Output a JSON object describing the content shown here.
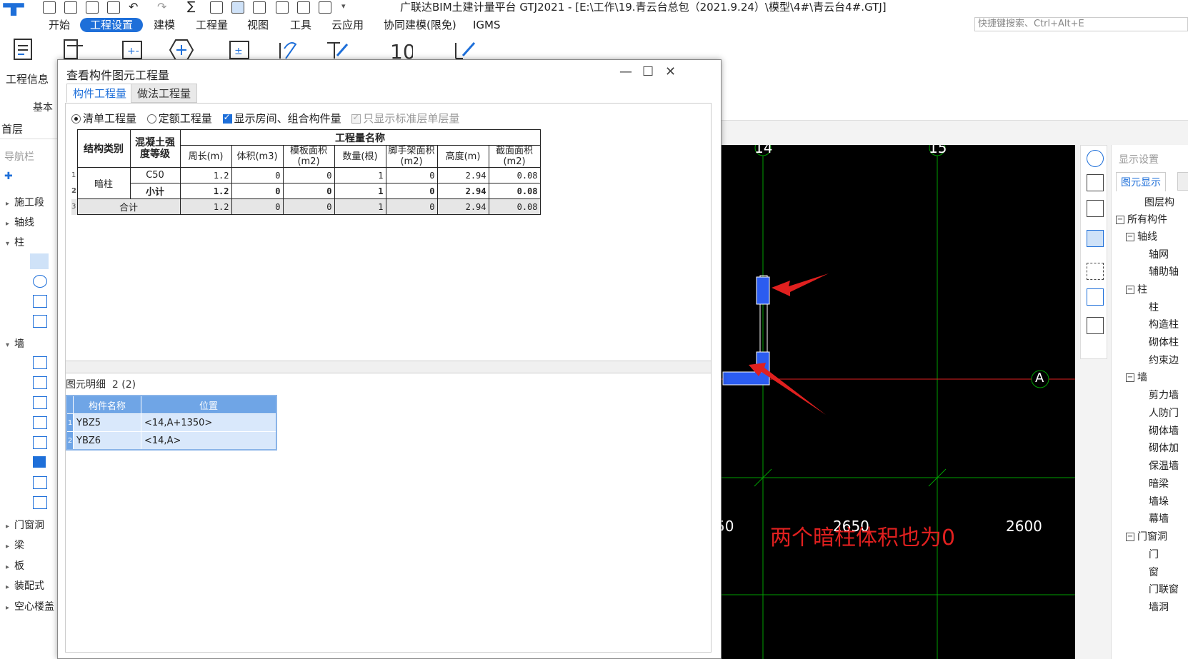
{
  "app": {
    "title": "广联达BIM土建计量平台 GTJ2021 - [E:\\工作\\19.青云台总包（2021.9.24）\\模型\\4#\\青云台4#.GTJ]",
    "logo": "T"
  },
  "menu": {
    "items": [
      "开始",
      "工程设置",
      "建模",
      "工程量",
      "视图",
      "工具",
      "云应用",
      "协同建模(限免)",
      "IGMS"
    ],
    "active": "工程设置"
  },
  "search": {
    "placeholder": "快捷键搜索、Ctrl+Alt+E"
  },
  "ribbon": {
    "info_label": "工程信息",
    "group_label": "基本",
    "icons": [
      "project-info-icon",
      "list-settings-icon",
      "calc-rules-icon",
      "add-icon",
      "calc-settings-icon",
      "rebar-icon",
      "edit-rule-icon",
      "number-icon",
      "check-icon"
    ]
  },
  "floor": {
    "current": "首层"
  },
  "nav": {
    "title": "导航栏",
    "nodes": [
      {
        "label": "施工段",
        "expanded": false
      },
      {
        "label": "轴线",
        "expanded": false
      },
      {
        "label": "柱",
        "expanded": true
      },
      {
        "label": "墙",
        "expanded": true
      },
      {
        "label": "门窗洞",
        "expanded": false
      },
      {
        "label": "梁",
        "expanded": false
      },
      {
        "label": "板",
        "expanded": false
      },
      {
        "label": "装配式",
        "expanded": false
      },
      {
        "label": "空心楼盖",
        "expanded": false
      }
    ]
  },
  "dialog": {
    "title": "查看构件图元工程量",
    "tabs": [
      "构件工程量",
      "做法工程量"
    ],
    "active_tab": "构件工程量",
    "options": {
      "list_qty": "清单工程量",
      "quota_qty": "定额工程量",
      "show_rooms": "显示房间、组合构件量",
      "std_floor_only": "只显示标准层单层量"
    },
    "qty_table": {
      "header_group": "工程量名称",
      "col_type": "结构类别",
      "col_grade": "混凝土强度等级",
      "columns": [
        "周长(m)",
        "体积(m3)",
        "模板面积(m2)",
        "数量(根)",
        "脚手架面积(m2)",
        "高度(m)",
        "截面面积(m2)"
      ],
      "rows": [
        {
          "rn": "1",
          "type": "暗柱",
          "grade": "C50",
          "values": [
            "1.2",
            "0",
            "0",
            "1",
            "0",
            "2.94",
            "0.08"
          ]
        },
        {
          "rn": "2",
          "type": "",
          "grade": "小计",
          "values": [
            "1.2",
            "0",
            "0",
            "1",
            "0",
            "2.94",
            "0.08"
          ]
        },
        {
          "rn": "3",
          "type": "合计",
          "grade": "",
          "values": [
            "1.2",
            "0",
            "0",
            "1",
            "0",
            "2.94",
            "0.08"
          ]
        }
      ]
    },
    "detail": {
      "label": "图元明细",
      "count": "2 (2)",
      "columns": [
        "构件名称",
        "位置"
      ],
      "rows": [
        {
          "rn": "1",
          "name": "YBZ5",
          "position": "<14,A+1350>"
        },
        {
          "rn": "2",
          "name": "YBZ6",
          "position": "<14,A>"
        }
      ]
    }
  },
  "canvas": {
    "axis_top": [
      "14",
      "15"
    ],
    "axis_side": "A",
    "dims": [
      "50",
      "2650",
      "2600"
    ],
    "colors": {
      "background": "#000000",
      "axis": "#00a000",
      "red": "#e0201f",
      "column": "#2b5cf0"
    }
  },
  "annotation": "两个暗柱体积也为0",
  "view_toolbar": {
    "icons": [
      "orbit-icon",
      "3d-icon",
      "box-icon",
      "box-dropdown-icon",
      "fullscreen-icon",
      "cube-icon",
      "view-settings-icon"
    ]
  },
  "display_panel": {
    "title": "显示设置",
    "tab": "图元显示",
    "rows": [
      {
        "label": "图层构",
        "level": 2
      },
      {
        "label": "所有构件",
        "level": 0,
        "box": "−"
      },
      {
        "label": "轴线",
        "level": 1,
        "box": "−"
      },
      {
        "label": "轴网",
        "level": 2
      },
      {
        "label": "辅助轴",
        "level": 2
      },
      {
        "label": "柱",
        "level": 1,
        "box": "−"
      },
      {
        "label": "柱",
        "level": 2
      },
      {
        "label": "构造柱",
        "level": 2
      },
      {
        "label": "砌体柱",
        "level": 2
      },
      {
        "label": "约束边",
        "level": 2
      },
      {
        "label": "墙",
        "level": 1,
        "box": "−"
      },
      {
        "label": "剪力墙",
        "level": 2
      },
      {
        "label": "人防门",
        "level": 2
      },
      {
        "label": "砌体墙",
        "level": 2
      },
      {
        "label": "砌体加",
        "level": 2
      },
      {
        "label": "保温墙",
        "level": 2
      },
      {
        "label": "暗梁",
        "level": 2
      },
      {
        "label": "墙垛",
        "level": 2
      },
      {
        "label": "幕墙",
        "level": 2
      },
      {
        "label": "门窗洞",
        "level": 1,
        "box": "−"
      },
      {
        "label": "门",
        "level": 2
      },
      {
        "label": "窗",
        "level": 2
      },
      {
        "label": "门联窗",
        "level": 2
      },
      {
        "label": "墙洞",
        "level": 2
      }
    ]
  }
}
